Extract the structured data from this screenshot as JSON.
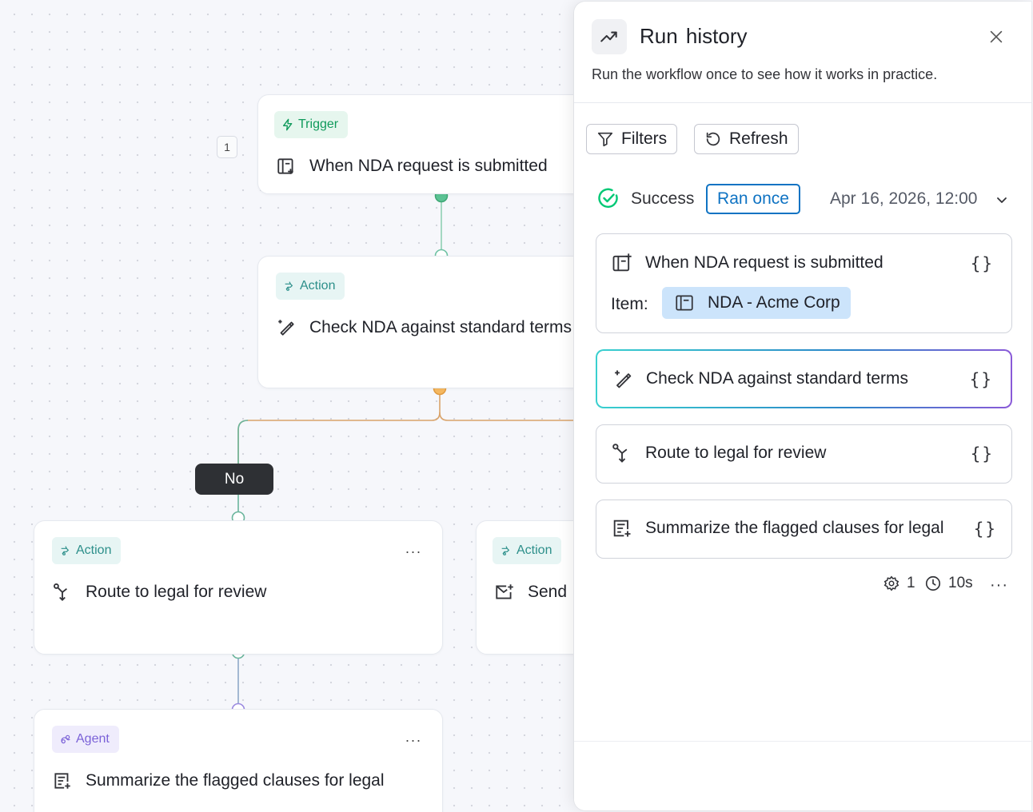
{
  "canvas": {
    "step_number": "1",
    "trigger_node": {
      "tag": "Trigger",
      "title": "When NDA request is submitted"
    },
    "check_node": {
      "tag": "Action",
      "title": "Check NDA against standard terms"
    },
    "branch_label": "No",
    "route_node": {
      "tag": "Action",
      "title": "Route to legal for review",
      "menu": "···"
    },
    "send_node": {
      "tag": "Action",
      "title": "Send"
    },
    "agent_node": {
      "tag": "Agent",
      "title": "Summarize the flagged clauses for legal",
      "menu": "···"
    },
    "colors": {
      "trigger": "#0f9a5b",
      "action": "#2c8f8a",
      "agent": "#7b62d8",
      "branch_orange": "#f2b15a",
      "branch_green": "#7fcfae"
    }
  },
  "panel": {
    "title": "Run history",
    "description": "Run the workflow once to see how it works in practice.",
    "filters_label": "Filters",
    "refresh_label": "Refresh",
    "run": {
      "status": "Success",
      "badge": "Ran once",
      "date": "Apr 16, 2026, 12:00"
    },
    "steps": [
      {
        "label": "When NDA request is submitted",
        "json": "{}",
        "icon": "trigger-board-icon"
      },
      {
        "label": "Check NDA against standard terms",
        "json": "{}",
        "icon": "magic-pen-icon"
      },
      {
        "label": "Route to legal for review",
        "json": "{}",
        "icon": "route-icon"
      },
      {
        "label": "Summarize the flagged clauses for legal",
        "json": "{}",
        "icon": "summarize-icon"
      }
    ],
    "item": {
      "label": "Item:",
      "value": "NDA - Acme Corp"
    },
    "meta": {
      "credits": "1",
      "duration": "10s",
      "more": "···"
    },
    "colors": {
      "success": "#00c875",
      "link": "#0f73c3"
    }
  }
}
